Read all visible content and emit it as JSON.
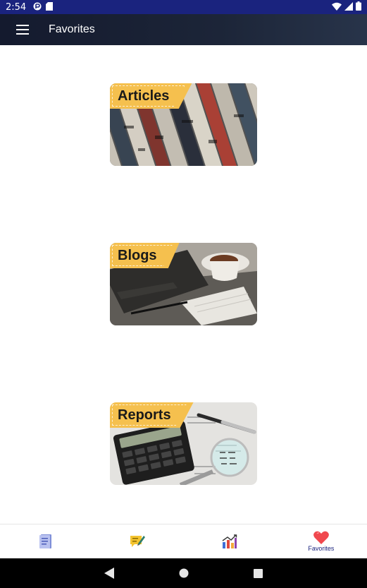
{
  "status_bar": {
    "time": "2:54"
  },
  "app_bar": {
    "title": "Favorites"
  },
  "cards": [
    {
      "label": "Articles"
    },
    {
      "label": "Blogs"
    },
    {
      "label": "Reports"
    }
  ],
  "bottom_nav": {
    "items": [
      {
        "icon": "document-icon",
        "label": ""
      },
      {
        "icon": "notes-icon",
        "label": ""
      },
      {
        "icon": "chart-icon",
        "label": ""
      },
      {
        "icon": "heart-icon",
        "label": "Favorites",
        "selected": true
      }
    ]
  },
  "colors": {
    "status_bar": "#1a237e",
    "app_bar": "#1c2538",
    "banner": "#f5c04e",
    "favorite_heart": "#f0484e",
    "nav_label": "#1a237e"
  }
}
